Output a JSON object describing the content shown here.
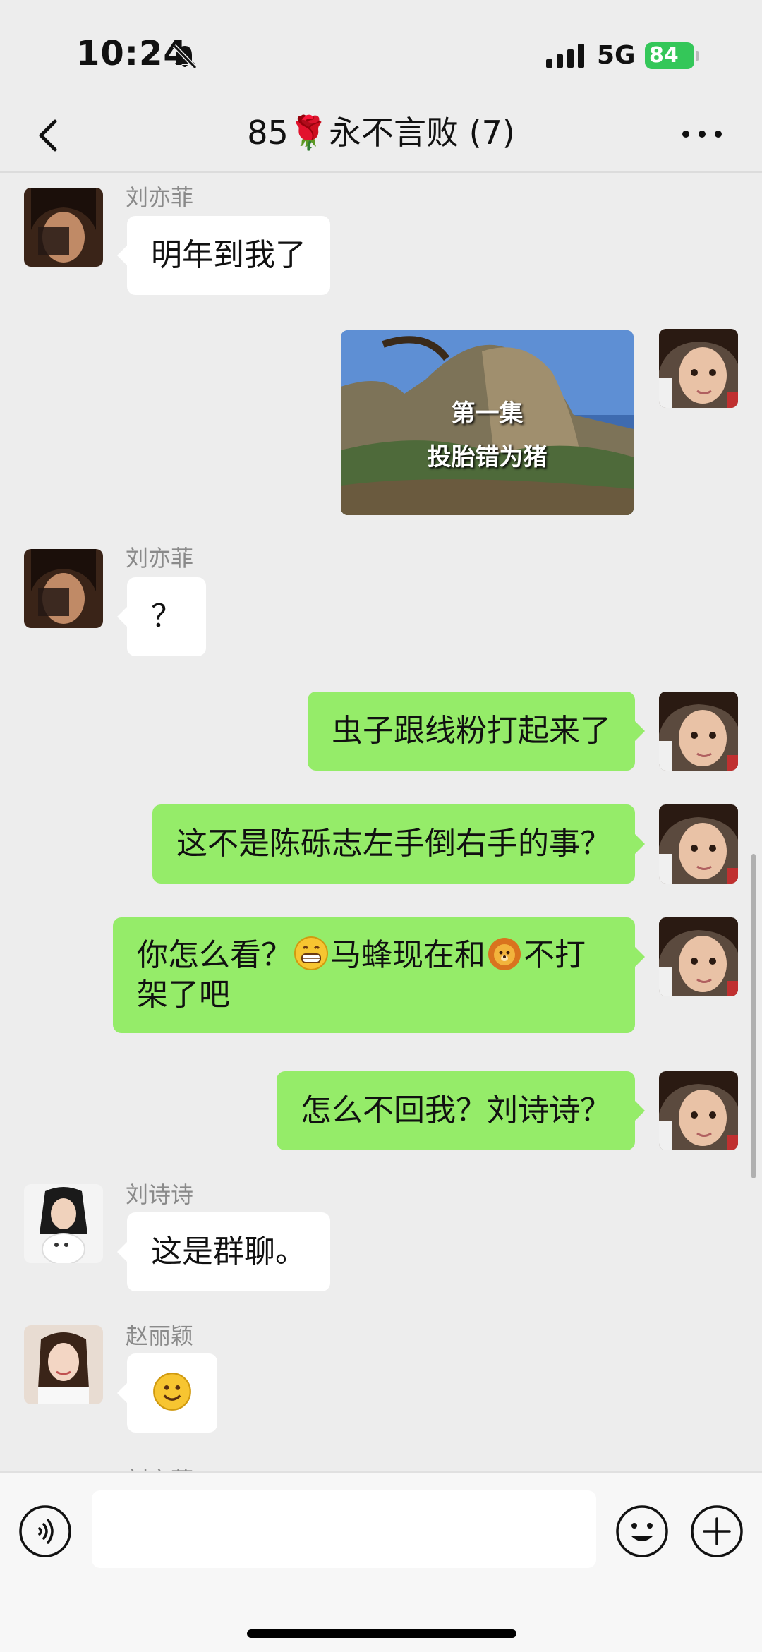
{
  "status_bar": {
    "time": "10:24",
    "network": "5G",
    "battery": "84"
  },
  "nav": {
    "title": "85🌹永不言败 (7)"
  },
  "messages": [
    {
      "sender": "刘亦菲",
      "text": "明年到我了"
    },
    {
      "type": "video",
      "line1": "第一集",
      "line2": "投胎错为猪"
    },
    {
      "sender": "刘亦菲",
      "text": "？"
    },
    {
      "text": "虫子跟线粉打起来了"
    },
    {
      "text": "这不是陈砾志左手倒右手的事？"
    },
    {
      "text_a": "你怎么看？",
      "text_b": "马蜂现在和",
      "text_c": "不打",
      "text_d": "架了吧"
    },
    {
      "text": "怎么不回我？刘诗诗？"
    },
    {
      "sender": "刘诗诗",
      "text": "这是群聊。"
    },
    {
      "sender": "赵丽颖",
      "text": "🙂"
    },
    {
      "sender": "刘亦菲"
    }
  ],
  "icons": [
    "back-icon",
    "more-icon",
    "voice-icon",
    "emoji-icon",
    "plus-icon",
    "mute-bell-icon",
    "signal-icon"
  ]
}
